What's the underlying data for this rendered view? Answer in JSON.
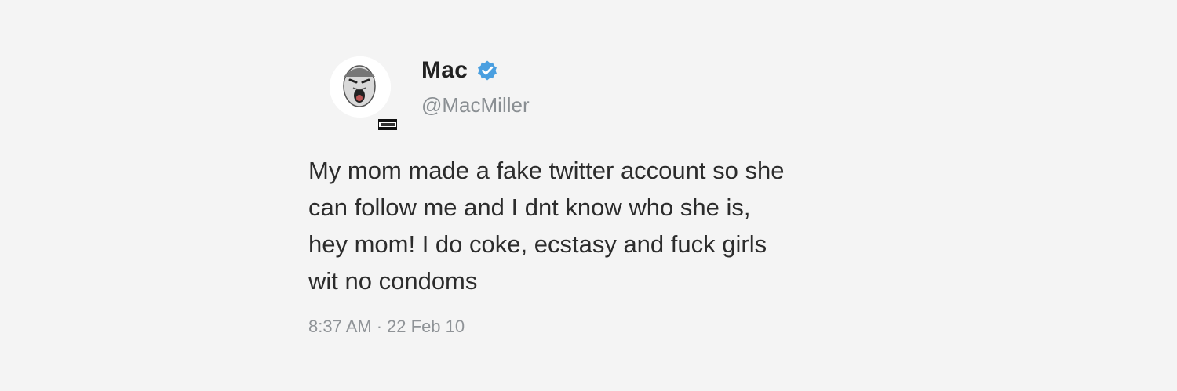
{
  "tweet": {
    "author": {
      "display_name": "Mac",
      "handle": "@MacMiller",
      "verified": true,
      "verified_icon": "verified-badge-icon",
      "avatar_icon": "avatar-face"
    },
    "text": "My mom made a fake twitter account so she\ncan follow me and I dnt know who she is,\nhey mom! I do coke, ecstasy and fuck girls\nwit no condoms",
    "time": "8:37 AM",
    "separator": "·",
    "date": "22 Feb 10"
  },
  "colors": {
    "background": "#f4f4f4",
    "verified_blue": "#4a9fe0",
    "meta_gray": "#8f9397"
  }
}
